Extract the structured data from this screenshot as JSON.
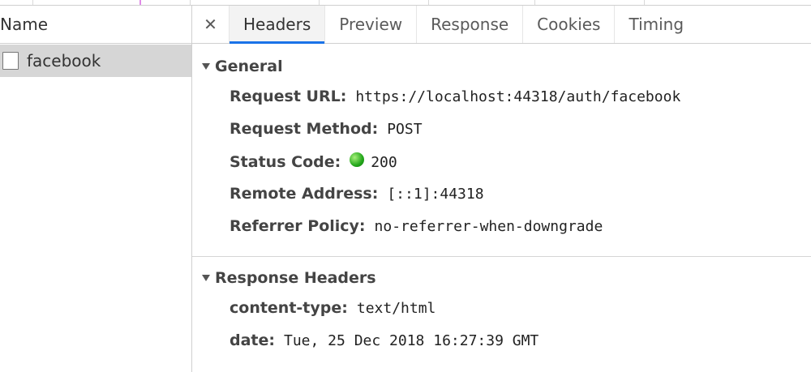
{
  "requests_list": {
    "column_header": "Name",
    "items": [
      {
        "name": "facebook"
      }
    ]
  },
  "tabs": [
    "Headers",
    "Preview",
    "Response",
    "Cookies",
    "Timing"
  ],
  "active_tab": "Headers",
  "sections": {
    "general": {
      "title": "General",
      "rows": [
        {
          "key": "Request URL:",
          "value": "https://localhost:44318/auth/facebook"
        },
        {
          "key": "Request Method:",
          "value": "POST"
        },
        {
          "key": "Status Code:",
          "value": "200",
          "status_color": "#22a61a"
        },
        {
          "key": "Remote Address:",
          "value": "[::1]:44318"
        },
        {
          "key": "Referrer Policy:",
          "value": "no-referrer-when-downgrade"
        }
      ]
    },
    "response_headers": {
      "title": "Response Headers",
      "rows": [
        {
          "key": "content-type:",
          "value": "text/html"
        },
        {
          "key": "date:",
          "value": "Tue, 25 Dec 2018 16:27:39 GMT"
        }
      ]
    }
  },
  "colors": {
    "active_tab_underline": "#1a73e8",
    "selected_row_bg": "#d6d6d6"
  }
}
